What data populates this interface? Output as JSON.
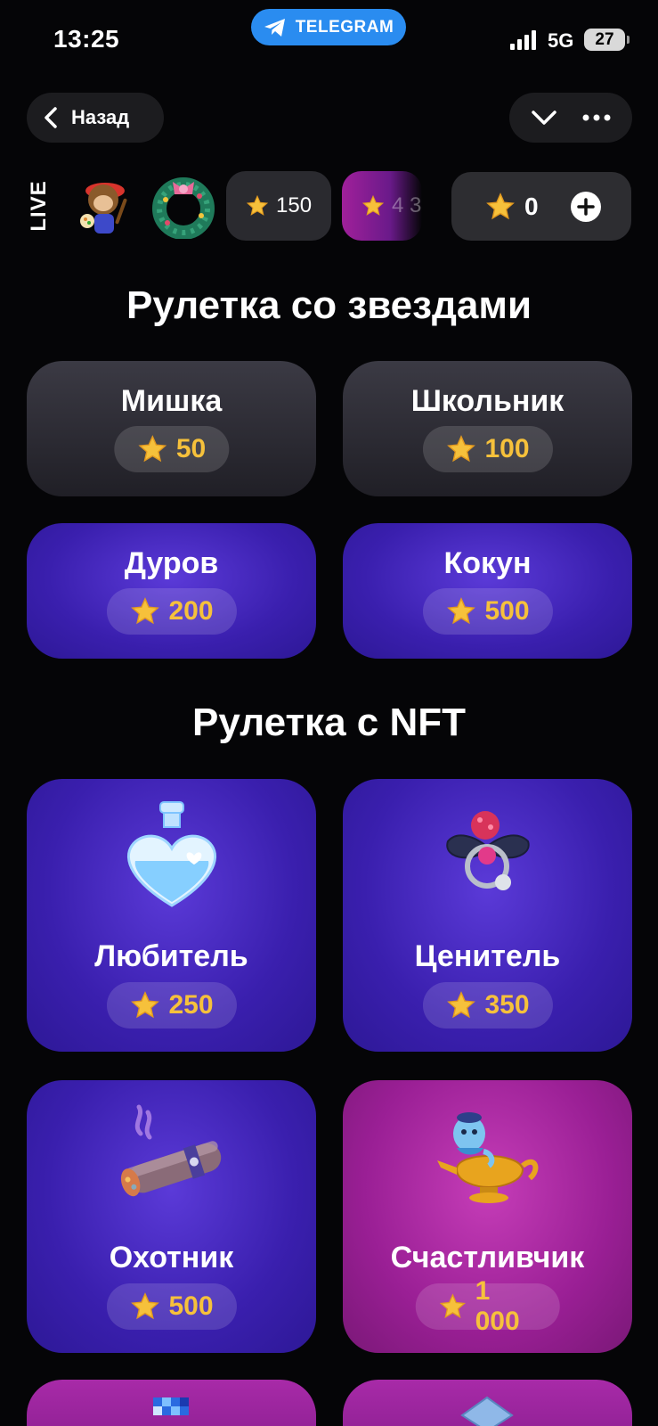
{
  "status_bar": {
    "time": "13:25",
    "pill_label": "TELEGRAM",
    "network": "5G",
    "battery": "27"
  },
  "nav": {
    "back_label": "Назад",
    "icons": [
      "chevron-left-icon",
      "chevron-down-icon",
      "more-icon"
    ]
  },
  "live": {
    "label": "LIVE",
    "items": [
      {
        "name": "painter-monkey-gift"
      },
      {
        "name": "wreath-gift"
      }
    ],
    "pills": [
      {
        "value": "150"
      },
      {
        "value": "4 3"
      }
    ]
  },
  "balance": {
    "value": "0"
  },
  "stars_section": {
    "title": "Рулетка со звездами",
    "cards": [
      {
        "title": "Мишка",
        "price": "50",
        "style": "dark"
      },
      {
        "title": "Школьник",
        "price": "100",
        "style": "dark"
      },
      {
        "title": "Дуров",
        "price": "200",
        "style": "violet"
      },
      {
        "title": "Кокун",
        "price": "500",
        "style": "violet"
      }
    ]
  },
  "nft_section": {
    "title": "Рулетка с NFT",
    "cards": [
      {
        "title": "Любитель",
        "price": "250",
        "style": "violet",
        "art": "love-potion-icon"
      },
      {
        "title": "Ценитель",
        "price": "350",
        "style": "violet",
        "art": "bow-ring-icon"
      },
      {
        "title": "Охотник",
        "price": "500",
        "style": "violet",
        "art": "cigar-icon"
      },
      {
        "title": "Счастливчик",
        "price": "1 000",
        "style": "magenta",
        "art": "genie-lamp-icon"
      }
    ]
  },
  "colors": {
    "background": "#050507",
    "accent_blue": "#2a8cf0",
    "price_gold": "#f6c13b",
    "violet": "#3a1fae",
    "magenta": "#9a1f95"
  }
}
